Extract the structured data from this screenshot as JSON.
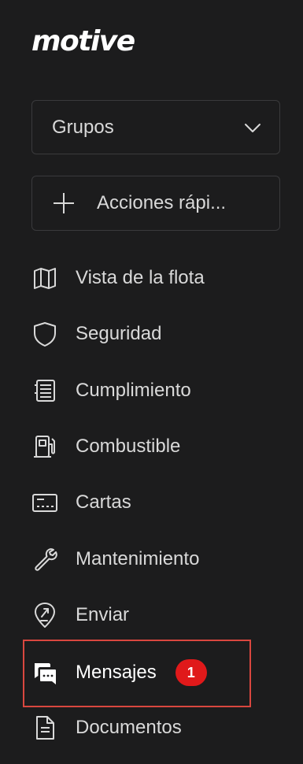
{
  "brand": {
    "logo_text": "motive"
  },
  "groups": {
    "label": "Grupos",
    "icon": "chevron-down-icon"
  },
  "quick_actions": {
    "label": "Acciones rápi...",
    "icon": "plus-icon"
  },
  "nav": {
    "items": [
      {
        "label": "Vista de la flota",
        "icon": "map-icon"
      },
      {
        "label": "Seguridad",
        "icon": "shield-icon"
      },
      {
        "label": "Cumplimiento",
        "icon": "document-list-icon"
      },
      {
        "label": "Combustible",
        "icon": "fuel-pump-icon"
      },
      {
        "label": "Cartas",
        "icon": "card-icon"
      },
      {
        "label": "Mantenimiento",
        "icon": "wrench-icon"
      },
      {
        "label": "Enviar",
        "icon": "dispatch-pin-icon"
      },
      {
        "label": "Mensajes",
        "icon": "chat-bubbles-icon",
        "badge": "1",
        "active": true
      },
      {
        "label": "Documentos",
        "icon": "document-icon"
      }
    ]
  },
  "colors": {
    "background": "#1c1c1d",
    "text": "#d9d9d9",
    "text_active": "#ffffff",
    "badge": "#e0191a",
    "highlight_border": "#d9473f",
    "border": "#3a3a3c"
  }
}
